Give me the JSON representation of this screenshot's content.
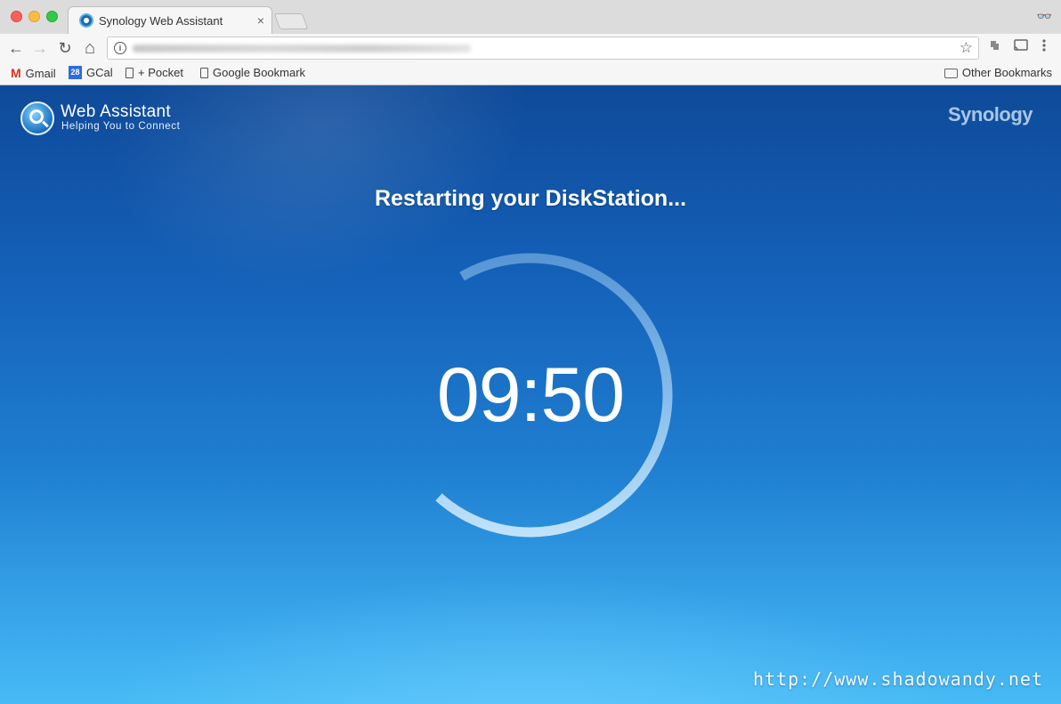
{
  "browser": {
    "tab_title": "Synology Web Assistant",
    "tab_close": "×",
    "incognito_icon": "👓",
    "nav": {
      "back": "←",
      "forward": "→",
      "reload": "↻",
      "home": "⌂"
    },
    "info_glyph": "i",
    "star_glyph": "☆",
    "bookmarks": [
      {
        "label": "Gmail",
        "icon": "gmail-icon"
      },
      {
        "label": "GCal",
        "icon": "calendar-icon",
        "badge": "28"
      },
      {
        "label": "+ Pocket",
        "icon": "page-icon"
      },
      {
        "label": "Google Bookmark",
        "icon": "page-icon"
      }
    ],
    "other_bookmarks": "Other Bookmarks"
  },
  "header": {
    "title": "Web Assistant",
    "subtitle": "Helping You to Connect",
    "brand": "Synology"
  },
  "main": {
    "headline": "Restarting your DiskStation...",
    "countdown": "09:50",
    "progress_fraction": 0.7
  },
  "watermark": "http://www.shadowandy.net",
  "colors": {
    "ring_track": "#6aa8de",
    "ring_fill": "#bfe2f8"
  }
}
